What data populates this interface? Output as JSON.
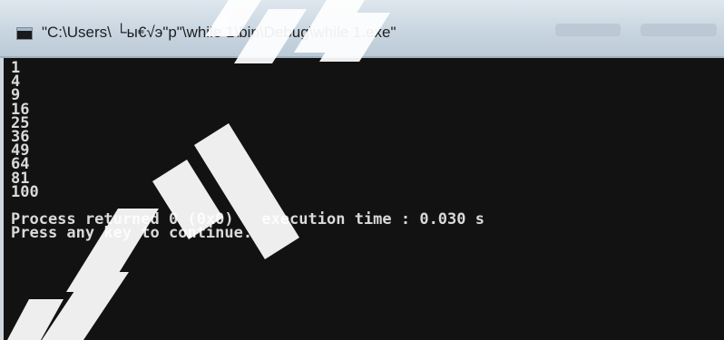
{
  "window": {
    "title": "\"C:\\Users\\ └ы€√э\"р\"\\while 1\\bin\\Debug\\while 1.exe\""
  },
  "console": {
    "output_lines": [
      "1",
      "4",
      "9",
      "16",
      "25",
      "36",
      "49",
      "64",
      "81",
      "100"
    ],
    "status_line": "Process returned 0 (0x0)   execution time : 0.030 s",
    "prompt_line": "Press any key to continue."
  },
  "colors": {
    "console_background": "#121212",
    "console_text": "#d9d9d9",
    "titlebar": "#c9d6e1"
  },
  "icons": {
    "app": "console-app-icon"
  }
}
